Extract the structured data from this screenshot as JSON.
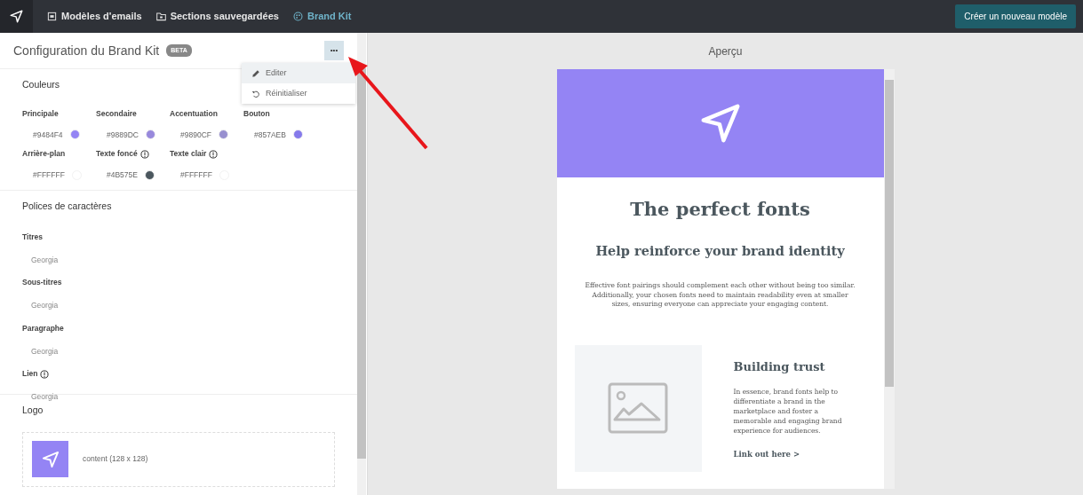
{
  "navbar": {
    "tabs": [
      {
        "label": "Modèles d'emails",
        "selected": false
      },
      {
        "label": "Sections sauvegardées",
        "selected": false
      },
      {
        "label": "Brand Kit",
        "selected": true
      }
    ],
    "create_button": "Créer un nouveau modèle"
  },
  "panel": {
    "title": "Configuration du Brand Kit",
    "badge": "BETA",
    "more_button": "•••",
    "menu": [
      {
        "label": "Editer",
        "selected": true
      },
      {
        "label": "Réinitialiser",
        "selected": false
      }
    ],
    "colors": {
      "heading": "Couleurs",
      "items": [
        {
          "label": "Principale",
          "value": "#9484F4",
          "color": "#9484f4",
          "info": false
        },
        {
          "label": "Secondaire",
          "value": "#9889DC",
          "color": "#9889dc",
          "info": false
        },
        {
          "label": "Accentuation",
          "value": "#9890CF",
          "color": "#9890cf",
          "info": false
        },
        {
          "label": "Bouton",
          "value": "#857AEB",
          "color": "#857aeb",
          "info": false
        },
        {
          "label": "Arrière-plan",
          "value": "#FFFFFF",
          "color": "#ffffff",
          "info": false
        },
        {
          "label": "Texte foncé",
          "value": "#4B575E",
          "color": "#4b575e",
          "info": true
        },
        {
          "label": "Texte clair",
          "value": "#FFFFFF",
          "color": "#ffffff",
          "info": true
        }
      ]
    },
    "fonts": {
      "heading": "Polices de caractères",
      "items": [
        {
          "label": "Titres",
          "value": "Georgia",
          "info": false
        },
        {
          "label": "Sous-titres",
          "value": "Georgia",
          "info": false
        },
        {
          "label": "Paragraphe",
          "value": "Georgia",
          "info": false
        },
        {
          "label": "Lien",
          "value": "Georgia",
          "info": true
        }
      ]
    },
    "logo": {
      "heading": "Logo",
      "caption": "content (128 x 128)"
    }
  },
  "preview": {
    "title": "Aperçu",
    "email": {
      "heading": "The perfect fonts",
      "subheading": "Help reinforce your brand identity",
      "intro": "Effective font pairings should complement each other without being too similar. Additionally, your chosen fonts need to maintain readability even at smaller sizes, ensuring everyone can appreciate your engaging content.",
      "card_title": "Building trust",
      "card_text": "In essence, brand fonts help to differentiate a brand in the marketplace and foster a memorable and engaging brand experience for audiences.",
      "card_link": "Link out here >"
    }
  }
}
